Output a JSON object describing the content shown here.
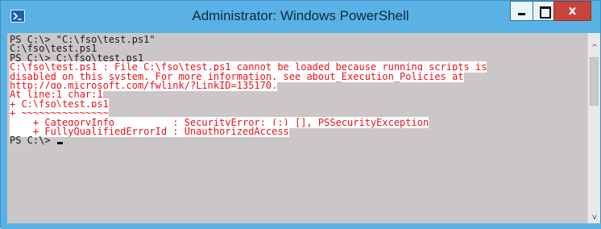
{
  "window": {
    "title": "Administrator: Windows PowerShell",
    "icons": {
      "app": "powershell-icon",
      "minimize": "minimize-icon",
      "maximize": "maximize-icon",
      "close": "close-icon"
    },
    "close_label": "x"
  },
  "console": {
    "lines": [
      {
        "text": "PS C:\\> \"C:\\fso\\test.ps1\"",
        "type": "normal"
      },
      {
        "text": "C:\\fso\\test.ps1",
        "type": "normal"
      },
      {
        "text": "PS C:\\> C:\\fso\\test.ps1",
        "type": "normal"
      },
      {
        "text": "C:\\fso\\test.ps1 : File C:\\fso\\test.ps1 cannot be loaded because running scripts is",
        "type": "error"
      },
      {
        "text": "disabled on this system. For more information, see about_Execution_Policies at",
        "type": "error"
      },
      {
        "text": "http://go.microsoft.com/fwlink/?LinkID=135170.",
        "type": "error"
      },
      {
        "text": "At line:1 char:1",
        "type": "error"
      },
      {
        "text": "+ C:\\fso\\test.ps1",
        "type": "error"
      },
      {
        "text": "+ ~~~~~~~~~~~~~~~",
        "type": "error"
      },
      {
        "text": "    + CategoryInfo          : SecurityError: (:) [], PSSecurityException",
        "type": "error"
      },
      {
        "text": "    + FullyQualifiedErrorId : UnauthorizedAccess",
        "type": "error"
      },
      {
        "text": "PS C:\\> ",
        "type": "prompt"
      }
    ],
    "colors": {
      "background": "#cbc7c9",
      "text": "#1a1a1a",
      "error_text": "#e8101b",
      "error_background": "#ffffff"
    }
  },
  "scrollbar": {
    "up_glyph": "^",
    "down_glyph": "v"
  }
}
